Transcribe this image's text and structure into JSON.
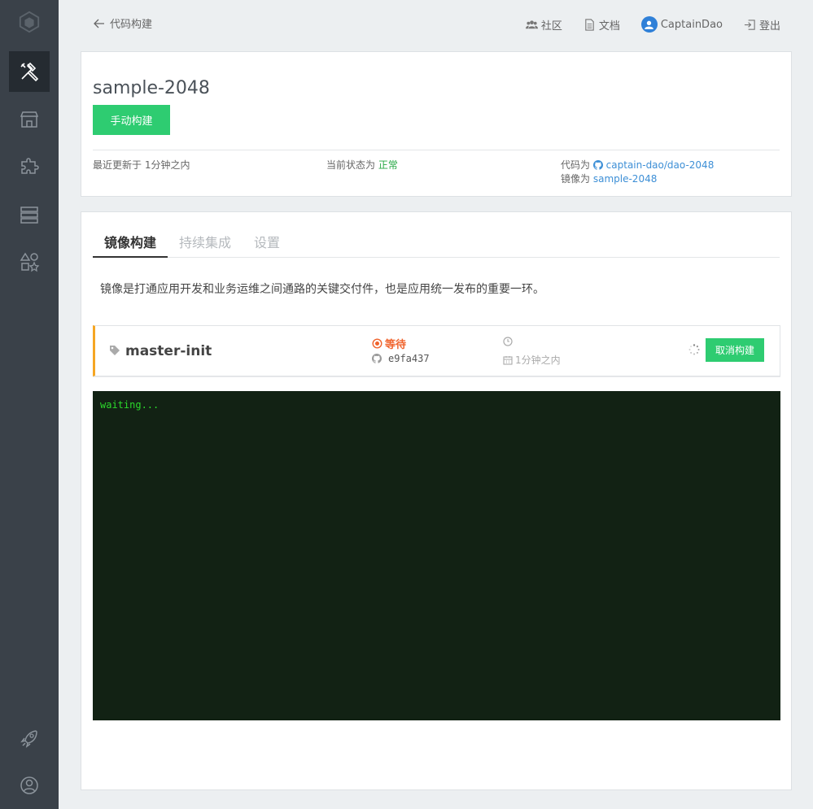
{
  "nav": {
    "back_label": "代码构建",
    "community": "社区",
    "docs": "文档",
    "user": "CaptainDao",
    "logout": "登出"
  },
  "project": {
    "name": "sample-2048",
    "manual_build_label": "手动构建",
    "last_updated_prefix": "最近更新于",
    "last_updated_value": "1分钟之内",
    "status_prefix": "当前状态为",
    "status_value": "正常",
    "code_prefix": "代码为",
    "code_repo": "captain-dao/dao-2048",
    "image_prefix": "镜像为",
    "image_name": "sample-2048"
  },
  "tabs": [
    "镜像构建",
    "持续集成",
    "设置"
  ],
  "description": "镜像是打通应用开发和业务运维之间通路的关键交付件，也是应用统一发布的重要一环。",
  "build": {
    "branch": "master-init",
    "status": "等待",
    "commit": "e9fa437",
    "time": "1分钟之内",
    "cancel_label": "取消构建"
  },
  "terminal": {
    "log": "waiting..."
  },
  "colors": {
    "sidebar": "#3a4149",
    "accent_green": "#2ecc71",
    "status_orange": "#f0632c",
    "link_blue": "#3d8fd6",
    "terminal_bg": "#122214",
    "terminal_text": "#2bd92b"
  },
  "icons": {
    "sidebar": [
      "logo-icon",
      "tools-icon",
      "store-icon",
      "puzzle-icon",
      "server-icon",
      "shapes-icon",
      "rocket-icon",
      "user-circle-icon"
    ]
  }
}
